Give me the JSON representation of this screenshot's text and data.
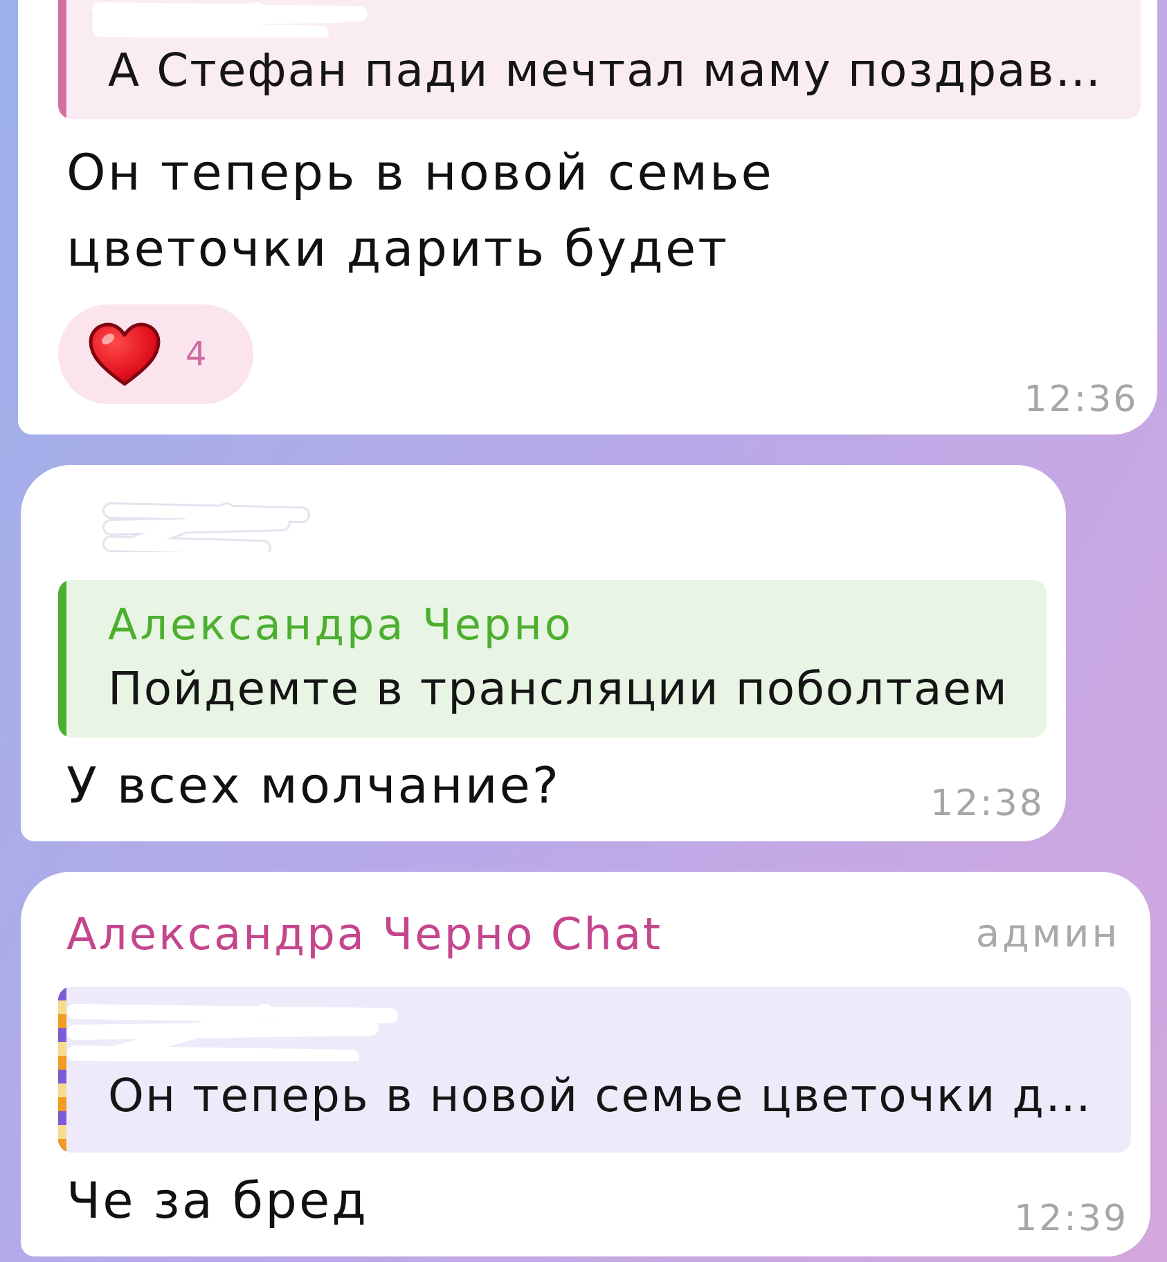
{
  "messages": [
    {
      "clipped_top": true,
      "reply": {
        "sender_redacted": true,
        "color": "#d46fa3",
        "text": "А Стефан пади мечтал маму поздрав…"
      },
      "text": "Он теперь в новой семье\nцветочки дарить будет",
      "reactions": [
        {
          "count": "4",
          "selected": false
        }
      ],
      "time": "12:36"
    },
    {
      "clipped_top": false,
      "sender_redacted": true,
      "reply": {
        "sender": "Александра Черно",
        "color": "#4caf2f",
        "text": "Пойдемте в трансляции поболтаем"
      },
      "text": "У всех молчание?",
      "time": "12:38"
    },
    {
      "clipped_top": false,
      "sender": {
        "name": "Александра Черно Chat",
        "color": "#c4468c"
      },
      "role": "админ",
      "reply": {
        "sender_redacted": true,
        "color": "#7c5cd6",
        "stripes": [
          {
            "color": "#f7dc8f"
          },
          {
            "color": "#f29b22"
          }
        ],
        "text": "Он теперь в новой семье цветочки д…"
      },
      "text": "Че за бред",
      "time": "12:39"
    }
  ]
}
